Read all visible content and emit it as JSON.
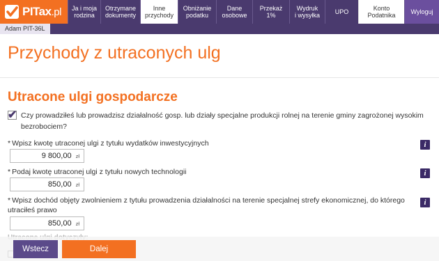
{
  "app": {
    "logo_main": "PITax",
    "logo_suffix": ".pl"
  },
  "nav": {
    "items": [
      {
        "label": "Ja i moja\nrodzina"
      },
      {
        "label": "Otrzymane\ndokumenty"
      },
      {
        "label": "Inne\nprzychody"
      },
      {
        "label": "Obniżanie\npodatku"
      },
      {
        "label": "Dane\nosobowe"
      },
      {
        "label": "Przekaż\n1%"
      },
      {
        "label": "Wydruk\ni wysyłka"
      },
      {
        "label": "UPO"
      },
      {
        "label": "Konto\nPodatnika"
      },
      {
        "label": "Wyloguj"
      }
    ]
  },
  "user": {
    "tab_label": "Adam PIT-36L"
  },
  "page": {
    "title": "Przychody z utraconych ulg",
    "section_title": "Utracone ulgi gospodarcze",
    "checkbox_label": "Czy prowadziłeś lub prowadzisz działalność gosp. lub działy specjalne produkcji rolnej na terenie gminy zagrożonej wysokim bezrobociem?",
    "checkbox_checked": true
  },
  "fields": [
    {
      "star": "*",
      "label": "Wpisz kwotę utraconej ulgi z tytułu wydatków inwestycyjnych",
      "value": "9 800,00",
      "unit": "zł"
    },
    {
      "star": "*",
      "label": "Podaj kwotę utraconej ulgi z tytułu nowych technologii",
      "value": "850,00",
      "unit": "zł"
    },
    {
      "star": "*",
      "label": "Wpisz dochód objęty zwolnieniem z tytułu prowadzenia działalności na terenie specjalnej strefy ekonomicznej, do którego utraciłeś prawo",
      "value": "850,00",
      "unit": "zł"
    }
  ],
  "info_glyph": "i",
  "sub_label": "Utracone ulgi dotyczyły:",
  "buttons": {
    "back": "Wstecz",
    "next": "Dalej"
  },
  "colors": {
    "accent": "#f37021",
    "nav_bg": "#4a3a6e",
    "button_back": "#5b4a8a"
  }
}
